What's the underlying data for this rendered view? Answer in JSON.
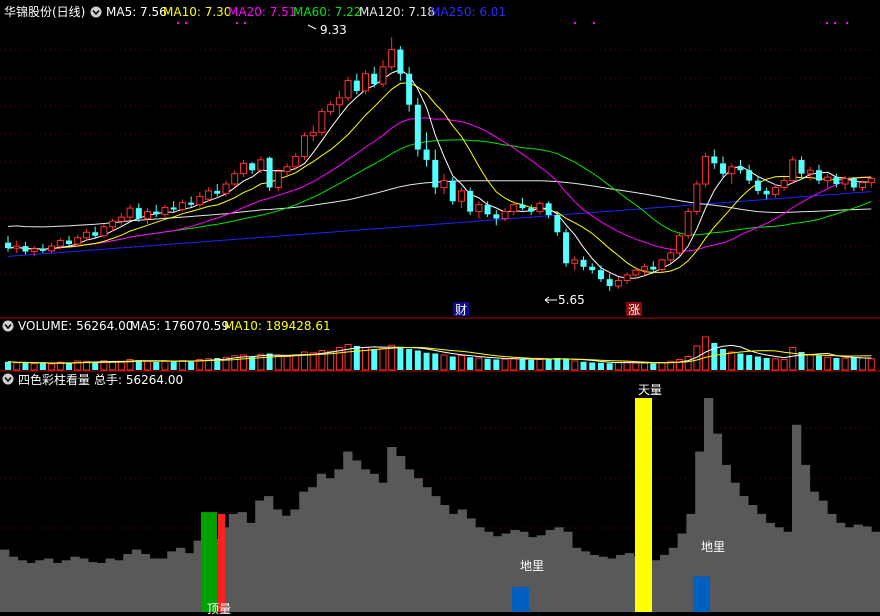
{
  "header": {
    "stock_name": "华锦股份(日线)",
    "ma5": "MA5: 7.56",
    "ma10": "MA10: 7.30",
    "ma20": "MA20: 7.51",
    "ma60": "MA60: 7.22",
    "ma120": "MA120: 7.18",
    "ma250": "MA250: 6.01"
  },
  "volume_header": {
    "volume": "VOLUME: 56264.00",
    "ma5": "MA5: 176070.59",
    "ma10": "MA10: 189428.61"
  },
  "indicator_header": {
    "name": "四色彩柱看量",
    "total": "总手: 56264.00"
  },
  "colors": {
    "up": "#ff3232",
    "down": "#54ffff",
    "ma5": "#ffffff",
    "ma10": "#ffff00",
    "ma20": "#ff00ff",
    "ma60": "#00e600",
    "ma120": "#e6e6e6",
    "ma250": "#2222ff",
    "grey_bar": "#595959",
    "green_bar": "#00a000",
    "red_bar": "#ff2020",
    "yellow_bar": "#ffff00",
    "blue_bar": "#0060c0"
  },
  "markers": {
    "high": "9.33",
    "low": "5.65",
    "cai": "财",
    "zhang": "涨"
  },
  "indicator_labels": {
    "diliang1": "地里",
    "diliang2": "地里",
    "tianliang": "天量",
    "bottom": "顶量"
  },
  "chart_data": {
    "type": "candlestick",
    "price_range": [
      5.3,
      9.55
    ],
    "candles": [
      [
        6.35,
        6.45,
        6.22,
        6.27
      ],
      [
        6.27,
        6.38,
        6.2,
        6.3
      ],
      [
        6.3,
        6.36,
        6.18,
        6.22
      ],
      [
        6.22,
        6.3,
        6.15,
        6.26
      ],
      [
        6.26,
        6.33,
        6.2,
        6.23
      ],
      [
        6.23,
        6.35,
        6.2,
        6.3
      ],
      [
        6.3,
        6.42,
        6.25,
        6.38
      ],
      [
        6.38,
        6.45,
        6.3,
        6.33
      ],
      [
        6.33,
        6.46,
        6.3,
        6.42
      ],
      [
        6.42,
        6.55,
        6.38,
        6.5
      ],
      [
        6.5,
        6.58,
        6.42,
        6.45
      ],
      [
        6.45,
        6.62,
        6.42,
        6.58
      ],
      [
        6.58,
        6.7,
        6.52,
        6.66
      ],
      [
        6.66,
        6.78,
        6.6,
        6.72
      ],
      [
        6.72,
        6.9,
        6.68,
        6.85
      ],
      [
        6.85,
        6.92,
        6.65,
        6.7
      ],
      [
        6.7,
        6.85,
        6.62,
        6.8
      ],
      [
        6.8,
        6.9,
        6.72,
        6.76
      ],
      [
        6.76,
        6.9,
        6.72,
        6.86
      ],
      [
        6.86,
        6.95,
        6.8,
        6.83
      ],
      [
        6.83,
        6.98,
        6.8,
        6.93
      ],
      [
        6.93,
        7.02,
        6.86,
        6.9
      ],
      [
        6.9,
        7.08,
        6.86,
        7.02
      ],
      [
        6.98,
        7.15,
        6.95,
        7.1
      ],
      [
        7.1,
        7.2,
        7.02,
        7.06
      ],
      [
        7.06,
        7.25,
        7.02,
        7.2
      ],
      [
        7.2,
        7.4,
        7.15,
        7.35
      ],
      [
        7.35,
        7.55,
        7.3,
        7.5
      ],
      [
        7.5,
        7.52,
        7.35,
        7.4
      ],
      [
        7.4,
        7.6,
        7.36,
        7.55
      ],
      [
        7.58,
        7.6,
        7.1,
        7.15
      ],
      [
        7.15,
        7.42,
        7.1,
        7.38
      ],
      [
        7.38,
        7.5,
        7.32,
        7.45
      ],
      [
        7.45,
        7.65,
        7.4,
        7.6
      ],
      [
        7.6,
        7.95,
        7.55,
        7.9
      ],
      [
        7.9,
        8.05,
        7.82,
        7.95
      ],
      [
        7.95,
        8.3,
        7.9,
        8.25
      ],
      [
        8.25,
        8.4,
        8.2,
        8.35
      ],
      [
        8.35,
        8.55,
        8.2,
        8.45
      ],
      [
        8.45,
        8.75,
        8.4,
        8.7
      ],
      [
        8.7,
        8.8,
        8.5,
        8.55
      ],
      [
        8.55,
        8.85,
        8.5,
        8.8
      ],
      [
        8.8,
        8.9,
        8.6,
        8.65
      ],
      [
        8.65,
        9.0,
        8.6,
        8.9
      ],
      [
        8.9,
        9.33,
        8.85,
        9.15
      ],
      [
        9.15,
        9.2,
        8.7,
        8.8
      ],
      [
        8.8,
        8.9,
        8.25,
        8.35
      ],
      [
        8.35,
        8.45,
        7.6,
        7.7
      ],
      [
        7.7,
        7.95,
        7.45,
        7.55
      ],
      [
        7.55,
        7.7,
        7.05,
        7.15
      ],
      [
        7.15,
        7.35,
        7.05,
        7.25
      ],
      [
        7.25,
        7.3,
        6.9,
        6.95
      ],
      [
        6.95,
        7.15,
        6.85,
        7.1
      ],
      [
        7.1,
        7.15,
        6.75,
        6.8
      ],
      [
        6.8,
        6.95,
        6.7,
        6.9
      ],
      [
        6.9,
        6.95,
        6.72,
        6.76
      ],
      [
        6.76,
        6.82,
        6.6,
        6.7
      ],
      [
        6.7,
        6.85,
        6.66,
        6.8
      ],
      [
        6.8,
        6.95,
        6.75,
        6.9
      ],
      [
        6.9,
        7.0,
        6.82,
        6.85
      ],
      [
        6.85,
        6.9,
        6.75,
        6.8
      ],
      [
        6.8,
        6.95,
        6.76,
        6.92
      ],
      [
        6.92,
        6.95,
        6.7,
        6.75
      ],
      [
        6.75,
        6.8,
        6.45,
        6.5
      ],
      [
        6.5,
        6.55,
        6.0,
        6.05
      ],
      [
        6.05,
        6.15,
        5.95,
        6.1
      ],
      [
        6.1,
        6.15,
        5.95,
        6.0
      ],
      [
        6.0,
        6.05,
        5.9,
        5.95
      ],
      [
        5.95,
        6.02,
        5.78,
        5.82
      ],
      [
        5.82,
        5.9,
        5.65,
        5.72
      ],
      [
        5.72,
        5.85,
        5.68,
        5.8
      ],
      [
        5.8,
        5.92,
        5.75,
        5.88
      ],
      [
        5.88,
        6.0,
        5.82,
        5.95
      ],
      [
        5.95,
        6.05,
        5.88,
        6.0
      ],
      [
        6.0,
        6.08,
        5.9,
        5.96
      ],
      [
        5.96,
        6.12,
        5.92,
        6.1
      ],
      [
        6.1,
        6.25,
        6.05,
        6.2
      ],
      [
        6.2,
        6.5,
        6.15,
        6.45
      ],
      [
        6.45,
        6.85,
        6.4,
        6.8
      ],
      [
        6.8,
        7.25,
        6.75,
        7.2
      ],
      [
        7.2,
        7.65,
        7.15,
        7.6
      ],
      [
        7.6,
        7.7,
        7.42,
        7.5
      ],
      [
        7.5,
        7.6,
        7.3,
        7.35
      ],
      [
        7.35,
        7.5,
        7.2,
        7.45
      ],
      [
        7.45,
        7.55,
        7.35,
        7.4
      ],
      [
        7.4,
        7.48,
        7.2,
        7.25
      ],
      [
        7.25,
        7.32,
        7.05,
        7.1
      ],
      [
        7.1,
        7.15,
        6.98,
        7.05
      ],
      [
        7.05,
        7.2,
        7.0,
        7.15
      ],
      [
        7.15,
        7.3,
        7.1,
        7.25
      ],
      [
        7.25,
        7.6,
        7.2,
        7.55
      ],
      [
        7.55,
        7.6,
        7.3,
        7.35
      ],
      [
        7.35,
        7.45,
        7.25,
        7.4
      ],
      [
        7.4,
        7.48,
        7.2,
        7.25
      ],
      [
        7.25,
        7.35,
        7.15,
        7.3
      ],
      [
        7.3,
        7.35,
        7.15,
        7.2
      ],
      [
        7.2,
        7.32,
        7.12,
        7.28
      ],
      [
        7.28,
        7.3,
        7.1,
        7.15
      ],
      [
        7.15,
        7.25,
        7.1,
        7.22
      ],
      [
        7.22,
        7.3,
        7.15,
        7.28
      ]
    ],
    "volume": [
      55,
      48,
      50,
      42,
      45,
      40,
      52,
      46,
      60,
      58,
      50,
      62,
      56,
      58,
      70,
      65,
      60,
      54,
      58,
      60,
      62,
      55,
      70,
      75,
      80,
      85,
      95,
      100,
      88,
      105,
      110,
      95,
      90,
      100,
      120,
      115,
      130,
      125,
      150,
      170,
      160,
      150,
      140,
      145,
      165,
      155,
      140,
      130,
      115,
      110,
      100,
      90,
      95,
      85,
      80,
      75,
      70,
      72,
      78,
      74,
      68,
      70,
      76,
      80,
      75,
      60,
      55,
      50,
      48,
      45,
      50,
      52,
      48,
      46,
      44,
      50,
      58,
      70,
      90,
      160,
      220,
      180,
      140,
      120,
      110,
      100,
      90,
      80,
      75,
      70,
      150,
      120,
      100,
      95,
      85,
      80,
      78,
      82,
      80,
      75
    ],
    "indicator_bars": [
      70,
      62,
      58,
      55,
      58,
      60,
      55,
      58,
      62,
      60,
      56,
      55,
      60,
      58,
      65,
      70,
      65,
      60,
      60,
      68,
      72,
      66,
      80,
      85,
      82,
      95,
      110,
      112,
      100,
      125,
      130,
      115,
      108,
      115,
      135,
      140,
      155,
      150,
      160,
      180,
      170,
      160,
      155,
      145,
      185,
      175,
      160,
      150,
      140,
      130,
      120,
      110,
      115,
      105,
      95,
      90,
      85,
      88,
      92,
      90,
      84,
      86,
      92,
      95,
      90,
      72,
      68,
      64,
      62,
      60,
      64,
      66,
      62,
      60,
      58,
      64,
      72,
      88,
      110,
      180,
      240,
      200,
      165,
      145,
      130,
      120,
      110,
      100,
      95,
      90,
      210,
      165,
      135,
      125,
      110,
      100,
      95,
      98,
      96,
      90
    ]
  }
}
